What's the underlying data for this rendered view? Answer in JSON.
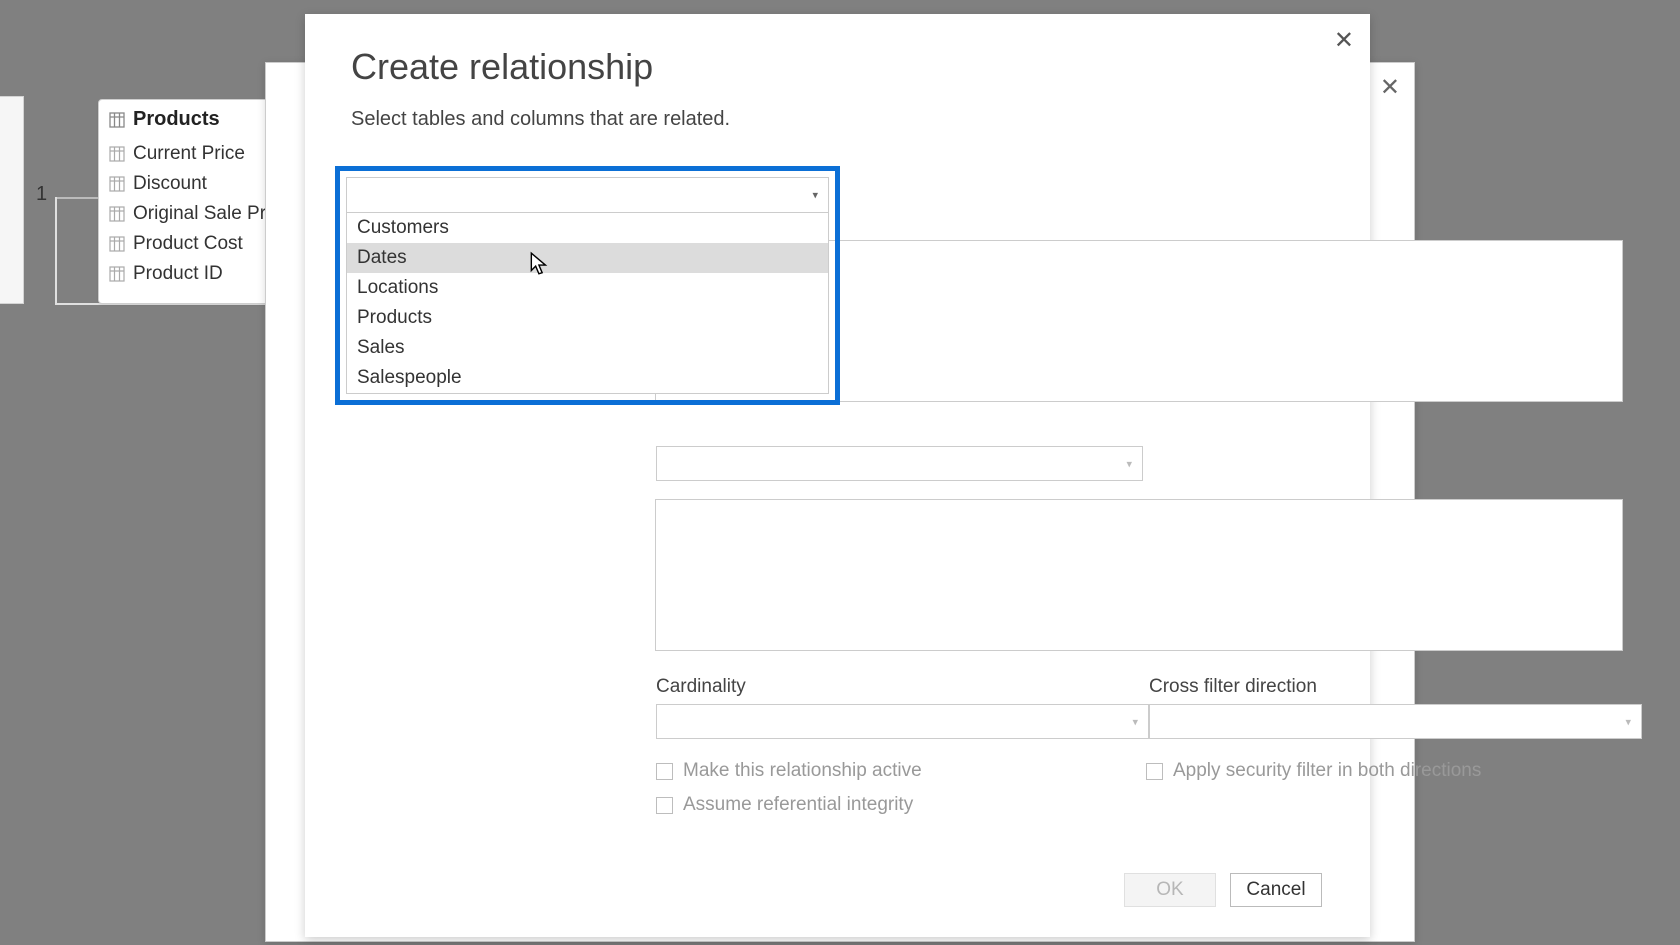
{
  "dialog": {
    "title": "Create relationship",
    "subtitle": "Select tables and columns that are related.",
    "dropdown_options": [
      "Customers",
      "Dates",
      "Locations",
      "Products",
      "Sales",
      "Salespeople"
    ],
    "hovered_index": 1,
    "cardinality_label": "Cardinality",
    "crossfilter_label": "Cross filter direction",
    "checkbox_active": "Make this relationship active",
    "checkbox_security": "Apply security filter in both directions",
    "checkbox_referential": "Assume referential integrity",
    "ok_label": "OK",
    "cancel_label": "Cancel"
  },
  "model_card": {
    "table_name": "Products",
    "columns": [
      "Current Price",
      "Discount",
      "Original Sale Pri",
      "Product Cost",
      "Product ID"
    ]
  },
  "connector": {
    "from_label": "1"
  }
}
